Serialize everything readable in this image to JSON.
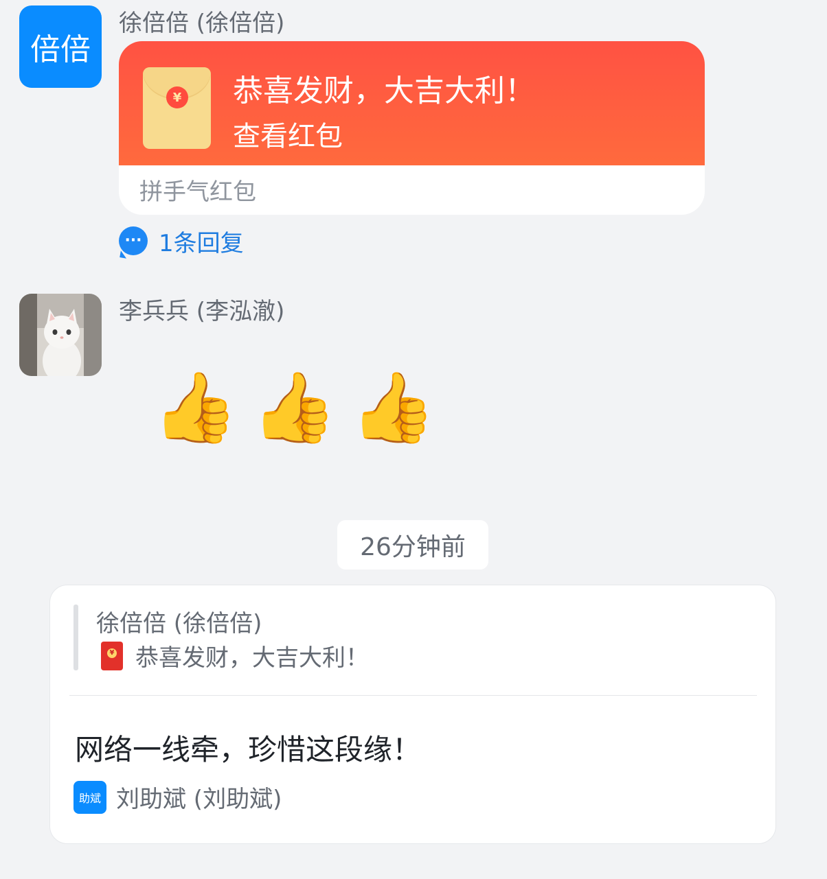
{
  "messages": [
    {
      "avatar_text": "倍倍",
      "sender": "徐倍倍 (徐倍倍)",
      "red_packet": {
        "title": "恭喜发财，大吉大利！",
        "action": "查看红包",
        "type": "拼手气红包",
        "icon": "red-envelope-icon"
      },
      "reply_count_label": "1条回复"
    },
    {
      "sender": "李兵兵 (李泓澈)",
      "emojis": [
        "👍",
        "👍",
        "👍"
      ]
    }
  ],
  "timestamp": "26分钟前",
  "reply_card": {
    "quote_author": "徐倍倍 (徐倍倍)",
    "quote_text": "恭喜发财，大吉大利！",
    "message": "网络一线牵，珍惜这段缘！",
    "author_avatar_text": "助斌",
    "author": "刘助斌 (刘助斌)"
  },
  "colors": {
    "accent_blue": "#0a8cff",
    "red_packet": "#ff5243",
    "background": "#f2f3f5"
  }
}
